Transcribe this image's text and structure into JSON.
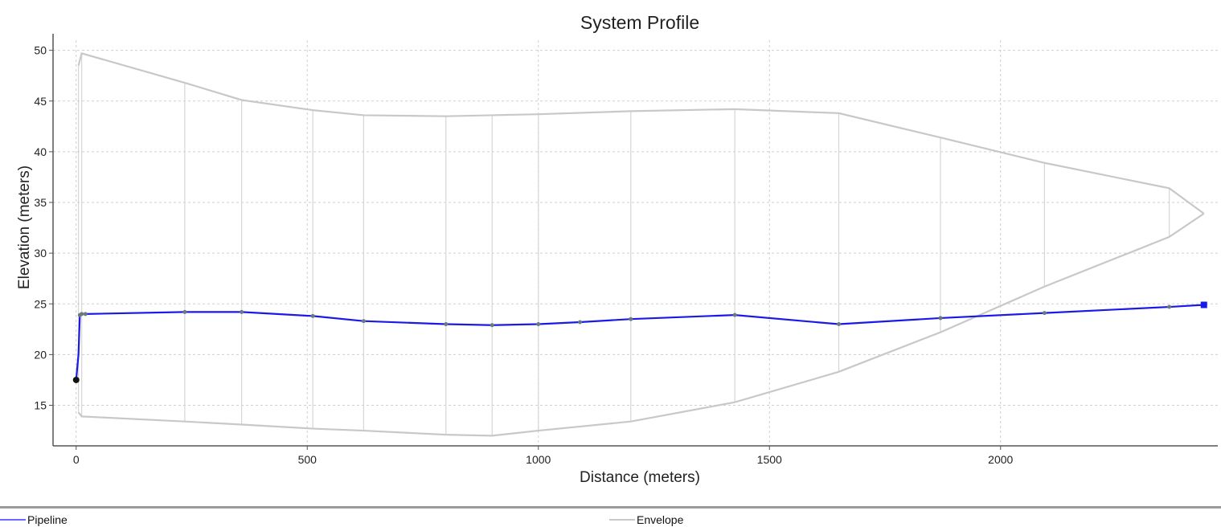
{
  "chart_data": {
    "type": "line",
    "title": "System Profile",
    "xlabel": "Distance (meters)",
    "ylabel": "Elevation (meters)",
    "xlim": [
      -50,
      2470
    ],
    "ylim": [
      11,
      51
    ],
    "xticks": [
      0,
      500,
      1000,
      1500,
      2000
    ],
    "yticks": [
      15,
      20,
      25,
      30,
      35,
      40,
      45,
      50
    ],
    "grid": true,
    "legend_position": "bottom",
    "series": [
      {
        "name": "Pipeline",
        "color": "#1a1ae6",
        "x": [
          0,
          5,
          8,
          12,
          20,
          235,
          358,
          512,
          622,
          800,
          900,
          1000,
          1090,
          1200,
          1425,
          1650,
          1870,
          2095,
          2365,
          2440
        ],
        "y": [
          17.5,
          20,
          23.9,
          24.0,
          24.0,
          24.2,
          24.2,
          23.8,
          23.3,
          23.0,
          22.9,
          23.0,
          23.2,
          23.5,
          23.9,
          23.0,
          23.6,
          24.1,
          24.7,
          24.9
        ]
      },
      {
        "name": "Envelope",
        "color": "#c8c8c8",
        "upper": {
          "x": [
            5,
            12,
            235,
            358,
            512,
            622,
            800,
            900,
            1000,
            1200,
            1425,
            1650,
            1870,
            2095,
            2365,
            2440
          ],
          "y": [
            48.5,
            49.7,
            46.8,
            45.1,
            44.1,
            43.6,
            43.5,
            43.6,
            43.7,
            44.0,
            44.2,
            43.8,
            41.4,
            38.9,
            36.4,
            33.9
          ]
        },
        "lower": {
          "x": [
            5,
            12,
            235,
            358,
            512,
            622,
            800,
            900,
            1000,
            1200,
            1425,
            1650,
            1870,
            2095,
            2365,
            2440
          ],
          "y": [
            14.3,
            13.9,
            13.4,
            13.1,
            12.7,
            12.5,
            12.1,
            12.0,
            12.5,
            13.4,
            15.3,
            18.3,
            22.2,
            26.7,
            31.6,
            33.9
          ]
        }
      }
    ]
  },
  "legend": {
    "pipeline_label": "Pipeline",
    "envelope_label": "Envelope"
  }
}
